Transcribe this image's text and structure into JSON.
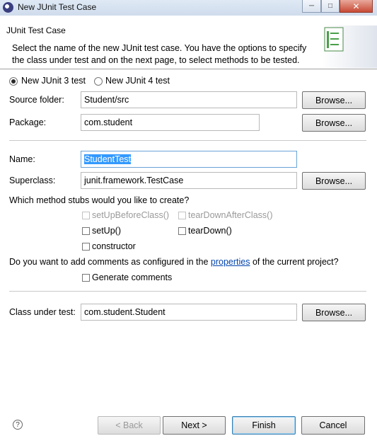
{
  "window": {
    "title": "New JUnit Test Case"
  },
  "header": {
    "title": "JUnit Test Case",
    "description": "Select the name of the new JUnit test case. You have the options to specify the class under test and on the next page, to select methods to be tested."
  },
  "version": {
    "junit3": "New JUnit 3 test",
    "junit4": "New JUnit 4 test",
    "selected": "junit3"
  },
  "source_folder": {
    "label": "Source folder:",
    "value": "Student/src",
    "browse": "Browse..."
  },
  "package": {
    "label": "Package:",
    "value": "com.student",
    "browse": "Browse..."
  },
  "name": {
    "label": "Name:",
    "value": "StudentTest"
  },
  "superclass": {
    "label": "Superclass:",
    "value": "junit.framework.TestCase",
    "browse": "Browse..."
  },
  "stubs": {
    "question": "Which method stubs would you like to create?",
    "setUpBeforeClass": "setUpBeforeClass()",
    "tearDownAfterClass": "tearDownAfterClass()",
    "setUp": "setUp()",
    "tearDown": "tearDown()",
    "constructor": "constructor"
  },
  "comments": {
    "question_before": "Do you want to add comments as configured in the",
    "link": "properties",
    "question_after": "of the current project?",
    "generate": "Generate comments"
  },
  "class_under_test": {
    "label": "Class under test:",
    "value": "com.student.Student",
    "browse": "Browse..."
  },
  "buttons": {
    "back": "< Back",
    "next": "Next >",
    "finish": "Finish",
    "cancel": "Cancel"
  },
  "icons": {
    "help": "?"
  }
}
